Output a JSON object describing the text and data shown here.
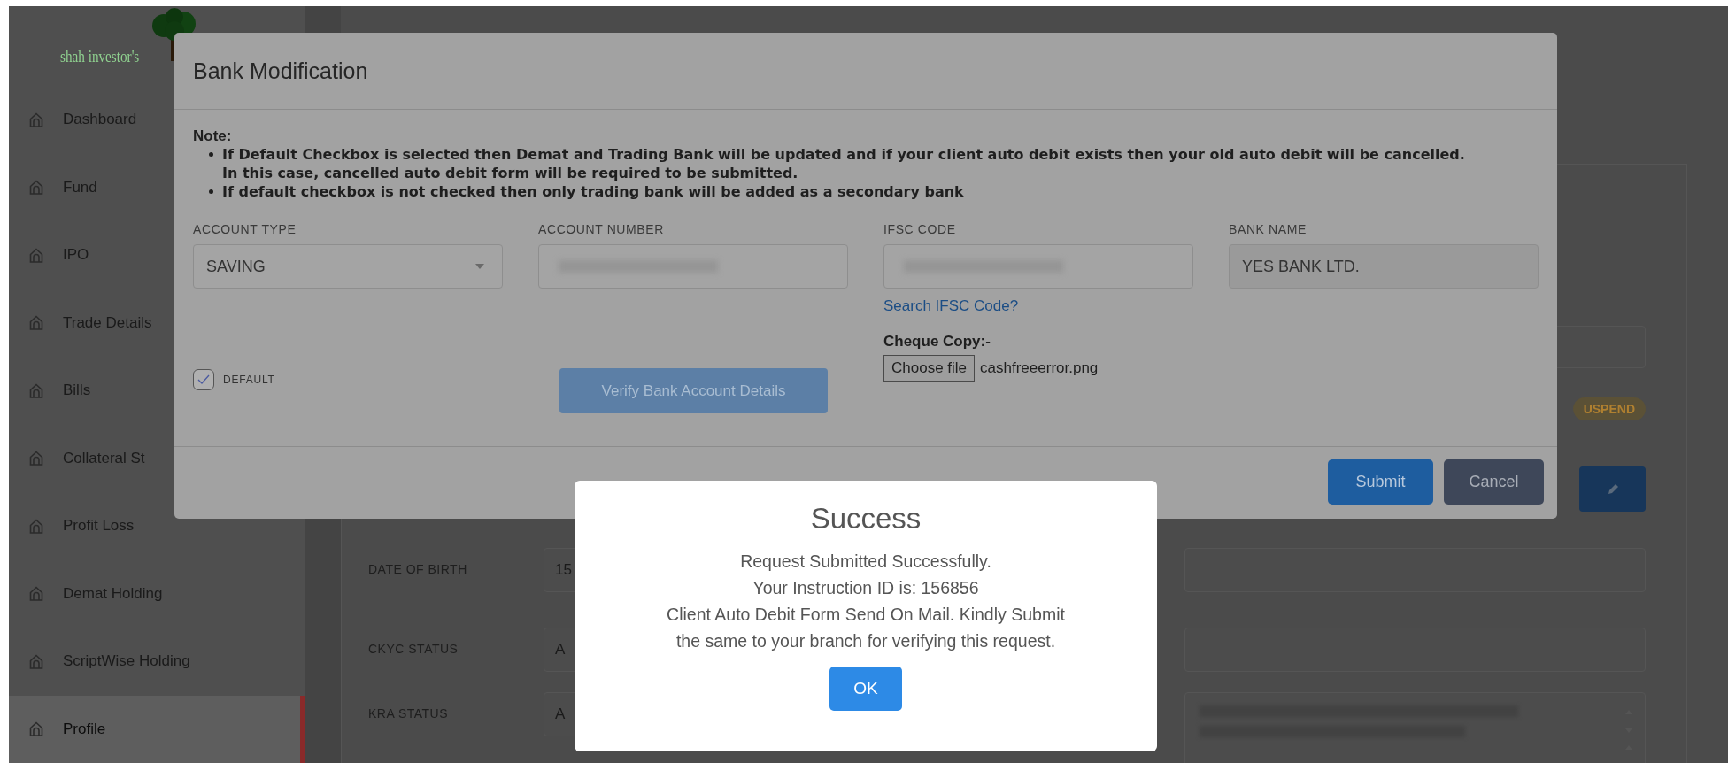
{
  "sidebar": {
    "logo_text": "shah investor's",
    "items": [
      {
        "label": "Dashboard",
        "selected": false
      },
      {
        "label": "Fund",
        "selected": false
      },
      {
        "label": "IPO",
        "selected": false
      },
      {
        "label": "Trade Details",
        "selected": false
      },
      {
        "label": "Bills",
        "selected": false
      },
      {
        "label": "Collateral St",
        "selected": false
      },
      {
        "label": "Profit Loss",
        "selected": false
      },
      {
        "label": "Demat Holding",
        "selected": false
      },
      {
        "label": "ScriptWise Holding",
        "selected": false
      },
      {
        "label": "Profile",
        "selected": true
      }
    ]
  },
  "profile": {
    "status_badge": "USPEND",
    "fields": [
      {
        "label": "DATE OF BIRTH",
        "value": "15"
      },
      {
        "label": "CKYC STATUS",
        "value": "A"
      },
      {
        "label": "KRA STATUS",
        "value": "A"
      }
    ]
  },
  "modal": {
    "title": "Bank Modification",
    "note": {
      "heading": "Note:",
      "bullets": [
        "If Default Checkbox is selected then Demat and Trading Bank will be updated and if your client auto debit exists then your old auto debit will be cancelled. In this case, cancelled auto debit form will be required to be submitted.",
        "If default checkbox is not checked then only trading bank will be added as a secondary bank"
      ]
    },
    "fields": [
      {
        "label": "ACCOUNT TYPE",
        "kind": "select",
        "value": "SAVING"
      },
      {
        "label": "ACCOUNT NUMBER",
        "kind": "masked"
      },
      {
        "label": "IFSC CODE",
        "kind": "masked"
      },
      {
        "label": "BANK NAME",
        "kind": "readonly",
        "value": "YES BANK LTD."
      }
    ],
    "ifsc_link": "Search IFSC Code?",
    "cheque": {
      "label": "Cheque Copy:-",
      "button": "Choose file",
      "file": "cashfreeerror.png"
    },
    "default_checkbox": {
      "label": "DEFAULT",
      "checked": true
    },
    "verify_button": "Verify Bank Account Details",
    "buttons": [
      {
        "label": "Submit",
        "kind": "primary"
      },
      {
        "label": "Cancel",
        "kind": "secondary"
      }
    ]
  },
  "dialog": {
    "title": "Success",
    "lines": [
      "Request Submitted Successfully.",
      "Your Instruction ID is: 156856",
      "Client Auto Debit Form Send On Mail. Kindly Submit the same to your branch for verifying this request."
    ],
    "button": "OK"
  }
}
